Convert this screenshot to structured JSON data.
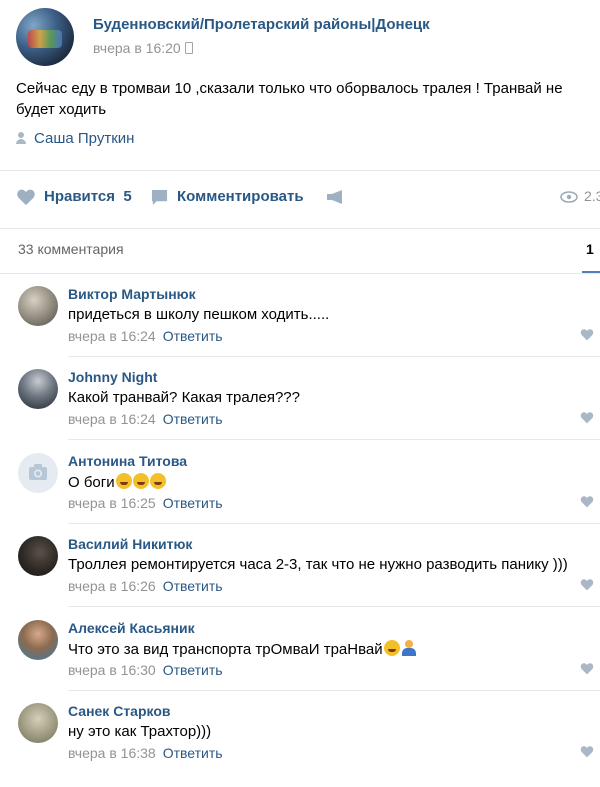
{
  "post": {
    "group_name": "Буденновский/Пролетарский районы|Донецк",
    "time": "вчера в 16:20",
    "text": "Сейчас еду в тромваи 10 ,сказали только что оборвалось тралея ! Транвай не будет ходить",
    "signer": "Саша Пруткин"
  },
  "actions": {
    "like_label": "Нравится",
    "like_count": "5",
    "comment_label": "Комментировать",
    "views": "2.3"
  },
  "comments_header": {
    "count_label": "33 комментария",
    "page": "1"
  },
  "reply_label": "Ответить",
  "comments": [
    {
      "author": "Виктор Мартынюк",
      "text": "придеться в школу пешком ходить.....",
      "time": "вчера в 16:24"
    },
    {
      "author": "Johnny Night",
      "text": "Какой транвай? Какая тралея???",
      "time": "вчера в 16:24"
    },
    {
      "author": "Антонина Титова",
      "text": "О боги",
      "time": "вчера в 16:25"
    },
    {
      "author": "Василий Никитюк",
      "text": "Троллея ремонтируется часа 2-3, так что не нужно разводить панику )))",
      "time": "вчера в 16:26"
    },
    {
      "author": "Алексей Касьяник",
      "text": "Что это за вид транспорта трОмваИ траНвай",
      "time": "вчера в 16:30"
    },
    {
      "author": "Санек Старков",
      "text": "ну это как Трахтор)))",
      "time": "вчера в 16:38"
    }
  ],
  "colors": {
    "link": "#2a5885",
    "muted": "#939393",
    "accent": "#5181b8",
    "divider": "#e7e8ec"
  }
}
